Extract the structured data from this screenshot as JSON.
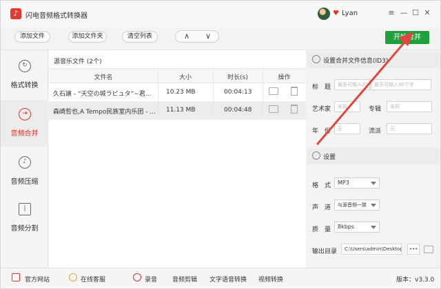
{
  "window": {
    "title": "闪电音频格式转换器",
    "username": "Lyan",
    "controls": [
      "≡",
      "—",
      "☐",
      "✕"
    ]
  },
  "toolbar": {
    "add_file": "添加文件",
    "add_folder": "添加文件夹",
    "clear_list": "清空列表",
    "move_up": "∧",
    "move_down": "∨",
    "start_merge": "开始合并"
  },
  "sidebar": {
    "items": [
      {
        "label": "格式转换",
        "icon": "refresh-icon"
      },
      {
        "label": "音频合并",
        "icon": "merge-icon",
        "active": true
      },
      {
        "label": "音频压缩",
        "icon": "compress-icon"
      },
      {
        "label": "音频分割",
        "icon": "split-icon"
      }
    ]
  },
  "file_list": {
    "title": "源音乐文件 (2个)",
    "columns": [
      "文件名",
      "大小",
      "时长(s)",
      "操作"
    ],
    "rows": [
      {
        "name": "久石譲 - “天空の城ラピュタ”~君...",
        "size": "10.23 MB",
        "duration": "00:04:13"
      },
      {
        "name": "森崎哲也,A Tempo民族室内乐团 - ...",
        "size": "11.13 MB",
        "duration": "00:04:48"
      }
    ]
  },
  "id3": {
    "header": "设置合并文件信息(ID3)",
    "title_label": "标　题",
    "title_placeholder": "最多可输入30个字",
    "title_placeholder2": "最多可输入30个字",
    "artist_label": "艺术家",
    "artist_placeholder": "未知",
    "album_label": "专辑",
    "album_placeholder": "未知",
    "year_label": "年　份",
    "year_placeholder": "无",
    "genre_label": "流派",
    "genre_placeholder": "无"
  },
  "settings": {
    "header": "设置",
    "format_label": "格　式",
    "format_value": "MP3",
    "channel_label": "声　道",
    "channel_value": "与源音频一致",
    "quality_label": "质　量",
    "quality_value": "8kbps",
    "output_label": "输出目录",
    "output_value": "C:\\Users\\admin\\Desktop",
    "more_label": "•••"
  },
  "bottom": {
    "website": "官方网站",
    "support": "在线客服",
    "record": "录音",
    "edit": "音频剪辑",
    "tts": "文字语音转换",
    "video": "视频转换",
    "version": "版本：v3.3.0"
  },
  "colors": {
    "accent": "#e0342c",
    "merge_button": "#1fa03c",
    "annotation_arrow": "#e2453a"
  }
}
